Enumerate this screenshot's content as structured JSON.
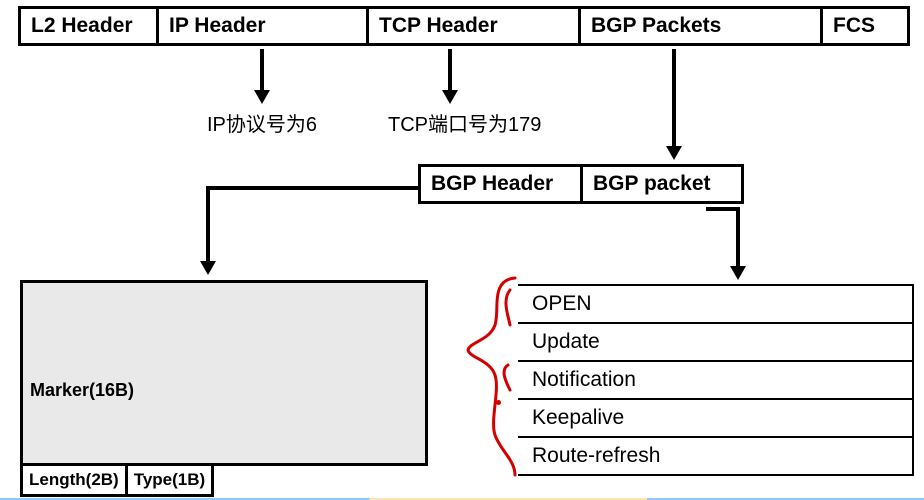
{
  "frame": {
    "l2": "L2 Header",
    "ip": "IP Header",
    "tcp": "TCP Header",
    "bgp_packets": "BGP Packets",
    "fcs": "FCS"
  },
  "annotations": {
    "ip_proto": "IP协议号为6",
    "tcp_port": "TCP端口号为179"
  },
  "bgp_row": {
    "header": "BGP Header",
    "packet": "BGP packet"
  },
  "bgp_header_fields": {
    "marker": "Marker(16B)",
    "length": "Length(2B)",
    "type": "Type(1B)"
  },
  "packet_types": {
    "open": "OPEN",
    "update": "Update",
    "notification": "Notification",
    "keepalive": "Keepalive",
    "route_refresh": "Route-refresh"
  }
}
